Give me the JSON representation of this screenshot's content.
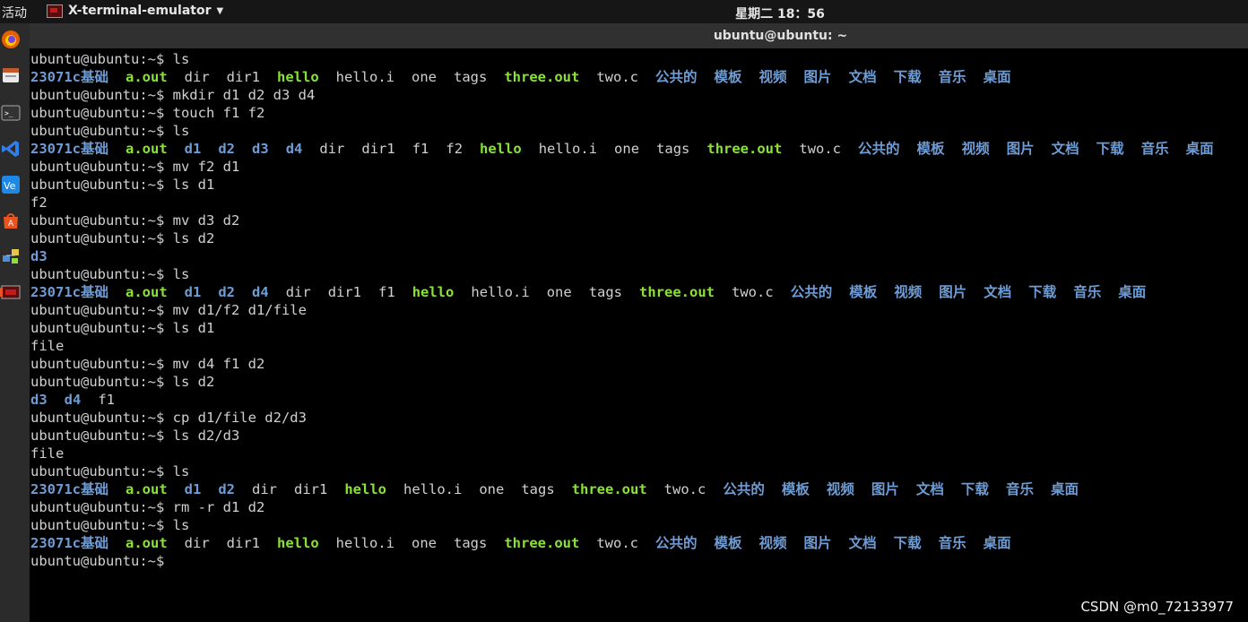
{
  "topbar": {
    "activities": "活动",
    "app_menu_label": "X-terminal-emulator",
    "clock": "星期二 18：56"
  },
  "dock": {
    "items": [
      "firefox-icon",
      "files-icon",
      "terminal-icon",
      "vscode-icon",
      "vmware-icon",
      "software-center-icon",
      "network-icon",
      "xterm-icon"
    ]
  },
  "window": {
    "title": "ubuntu@ubuntu: ~"
  },
  "colors": {
    "directory": "#6d9cd6",
    "executable": "#8ae234",
    "plain": "#d0d0d0"
  },
  "terminal": {
    "lines": [
      [
        {
          "t": "ubuntu@ubuntu:~$ ls",
          "k": "plain"
        }
      ],
      [
        {
          "t": "23071c基础",
          "k": "dir"
        },
        {
          "t": "a.out",
          "k": "exe"
        },
        {
          "t": "dir",
          "k": "plain"
        },
        {
          "t": "dir1",
          "k": "plain"
        },
        {
          "t": "hello",
          "k": "exe"
        },
        {
          "t": "hello.i",
          "k": "plain"
        },
        {
          "t": "one",
          "k": "plain"
        },
        {
          "t": "tags",
          "k": "plain"
        },
        {
          "t": "three.out",
          "k": "exe"
        },
        {
          "t": "two.c",
          "k": "plain"
        },
        {
          "t": "公共的",
          "k": "dir"
        },
        {
          "t": "模板",
          "k": "dir"
        },
        {
          "t": "视频",
          "k": "dir"
        },
        {
          "t": "图片",
          "k": "dir"
        },
        {
          "t": "文档",
          "k": "dir"
        },
        {
          "t": "下载",
          "k": "dir"
        },
        {
          "t": "音乐",
          "k": "dir"
        },
        {
          "t": "桌面",
          "k": "dir"
        }
      ],
      [
        {
          "t": "ubuntu@ubuntu:~$ mkdir d1 d2 d3 d4",
          "k": "plain"
        }
      ],
      [
        {
          "t": "ubuntu@ubuntu:~$ touch f1 f2",
          "k": "plain"
        }
      ],
      [
        {
          "t": "ubuntu@ubuntu:~$ ls",
          "k": "plain"
        }
      ],
      [
        {
          "t": "23071c基础",
          "k": "dir"
        },
        {
          "t": "a.out",
          "k": "exe"
        },
        {
          "t": "d1",
          "k": "dir"
        },
        {
          "t": "d2",
          "k": "dir"
        },
        {
          "t": "d3",
          "k": "dir"
        },
        {
          "t": "d4",
          "k": "dir"
        },
        {
          "t": "dir",
          "k": "plain"
        },
        {
          "t": "dir1",
          "k": "plain"
        },
        {
          "t": "f1",
          "k": "plain"
        },
        {
          "t": "f2",
          "k": "plain"
        },
        {
          "t": "hello",
          "k": "exe"
        },
        {
          "t": "hello.i",
          "k": "plain"
        },
        {
          "t": "one",
          "k": "plain"
        },
        {
          "t": "tags",
          "k": "plain"
        },
        {
          "t": "three.out",
          "k": "exe"
        },
        {
          "t": "two.c",
          "k": "plain"
        },
        {
          "t": "公共的",
          "k": "dir"
        },
        {
          "t": "模板",
          "k": "dir"
        },
        {
          "t": "视频",
          "k": "dir"
        },
        {
          "t": "图片",
          "k": "dir"
        },
        {
          "t": "文档",
          "k": "dir"
        },
        {
          "t": "下载",
          "k": "dir"
        },
        {
          "t": "音乐",
          "k": "dir"
        },
        {
          "t": "桌面",
          "k": "dir"
        }
      ],
      [
        {
          "t": "ubuntu@ubuntu:~$ mv f2 d1",
          "k": "plain"
        }
      ],
      [
        {
          "t": "ubuntu@ubuntu:~$ ls d1",
          "k": "plain"
        }
      ],
      [
        {
          "t": "f2",
          "k": "plain"
        }
      ],
      [
        {
          "t": "ubuntu@ubuntu:~$ mv d3 d2",
          "k": "plain"
        }
      ],
      [
        {
          "t": "ubuntu@ubuntu:~$ ls d2",
          "k": "plain"
        }
      ],
      [
        {
          "t": "d3",
          "k": "dir"
        }
      ],
      [
        {
          "t": "ubuntu@ubuntu:~$ ls",
          "k": "plain"
        }
      ],
      [
        {
          "t": "23071c基础",
          "k": "dir"
        },
        {
          "t": "a.out",
          "k": "exe"
        },
        {
          "t": "d1",
          "k": "dir"
        },
        {
          "t": "d2",
          "k": "dir"
        },
        {
          "t": "d4",
          "k": "dir"
        },
        {
          "t": "dir",
          "k": "plain"
        },
        {
          "t": "dir1",
          "k": "plain"
        },
        {
          "t": "f1",
          "k": "plain"
        },
        {
          "t": "hello",
          "k": "exe"
        },
        {
          "t": "hello.i",
          "k": "plain"
        },
        {
          "t": "one",
          "k": "plain"
        },
        {
          "t": "tags",
          "k": "plain"
        },
        {
          "t": "three.out",
          "k": "exe"
        },
        {
          "t": "two.c",
          "k": "plain"
        },
        {
          "t": "公共的",
          "k": "dir"
        },
        {
          "t": "模板",
          "k": "dir"
        },
        {
          "t": "视频",
          "k": "dir"
        },
        {
          "t": "图片",
          "k": "dir"
        },
        {
          "t": "文档",
          "k": "dir"
        },
        {
          "t": "下载",
          "k": "dir"
        },
        {
          "t": "音乐",
          "k": "dir"
        },
        {
          "t": "桌面",
          "k": "dir"
        }
      ],
      [
        {
          "t": "ubuntu@ubuntu:~$ mv d1/f2 d1/file",
          "k": "plain"
        }
      ],
      [
        {
          "t": "ubuntu@ubuntu:~$ ls d1",
          "k": "plain"
        }
      ],
      [
        {
          "t": "file",
          "k": "plain"
        }
      ],
      [
        {
          "t": "ubuntu@ubuntu:~$ mv d4 f1 d2",
          "k": "plain"
        }
      ],
      [
        {
          "t": "ubuntu@ubuntu:~$ ls d2",
          "k": "plain"
        }
      ],
      [
        {
          "t": "d3",
          "k": "dir"
        },
        {
          "t": "d4",
          "k": "dir"
        },
        {
          "t": "f1",
          "k": "plain"
        }
      ],
      [
        {
          "t": "ubuntu@ubuntu:~$ cp d1/file d2/d3",
          "k": "plain"
        }
      ],
      [
        {
          "t": "ubuntu@ubuntu:~$ ls d2/d3",
          "k": "plain"
        }
      ],
      [
        {
          "t": "file",
          "k": "plain"
        }
      ],
      [
        {
          "t": "ubuntu@ubuntu:~$ ls",
          "k": "plain"
        }
      ],
      [
        {
          "t": "23071c基础",
          "k": "dir"
        },
        {
          "t": "a.out",
          "k": "exe"
        },
        {
          "t": "d1",
          "k": "dir"
        },
        {
          "t": "d2",
          "k": "dir"
        },
        {
          "t": "dir",
          "k": "plain"
        },
        {
          "t": "dir1",
          "k": "plain"
        },
        {
          "t": "hello",
          "k": "exe"
        },
        {
          "t": "hello.i",
          "k": "plain"
        },
        {
          "t": "one",
          "k": "plain"
        },
        {
          "t": "tags",
          "k": "plain"
        },
        {
          "t": "three.out",
          "k": "exe"
        },
        {
          "t": "two.c",
          "k": "plain"
        },
        {
          "t": "公共的",
          "k": "dir"
        },
        {
          "t": "模板",
          "k": "dir"
        },
        {
          "t": "视频",
          "k": "dir"
        },
        {
          "t": "图片",
          "k": "dir"
        },
        {
          "t": "文档",
          "k": "dir"
        },
        {
          "t": "下载",
          "k": "dir"
        },
        {
          "t": "音乐",
          "k": "dir"
        },
        {
          "t": "桌面",
          "k": "dir"
        }
      ],
      [
        {
          "t": "ubuntu@ubuntu:~$ rm -r d1 d2",
          "k": "plain"
        }
      ],
      [
        {
          "t": "ubuntu@ubuntu:~$ ls",
          "k": "plain"
        }
      ],
      [
        {
          "t": "23071c基础",
          "k": "dir"
        },
        {
          "t": "a.out",
          "k": "exe"
        },
        {
          "t": "dir",
          "k": "plain"
        },
        {
          "t": "dir1",
          "k": "plain"
        },
        {
          "t": "hello",
          "k": "exe"
        },
        {
          "t": "hello.i",
          "k": "plain"
        },
        {
          "t": "one",
          "k": "plain"
        },
        {
          "t": "tags",
          "k": "plain"
        },
        {
          "t": "three.out",
          "k": "exe"
        },
        {
          "t": "two.c",
          "k": "plain"
        },
        {
          "t": "公共的",
          "k": "dir"
        },
        {
          "t": "模板",
          "k": "dir"
        },
        {
          "t": "视频",
          "k": "dir"
        },
        {
          "t": "图片",
          "k": "dir"
        },
        {
          "t": "文档",
          "k": "dir"
        },
        {
          "t": "下载",
          "k": "dir"
        },
        {
          "t": "音乐",
          "k": "dir"
        },
        {
          "t": "桌面",
          "k": "dir"
        }
      ],
      [
        {
          "t": "ubuntu@ubuntu:~$ ",
          "k": "plain"
        }
      ]
    ]
  },
  "watermark": "CSDN @m0_72133977"
}
